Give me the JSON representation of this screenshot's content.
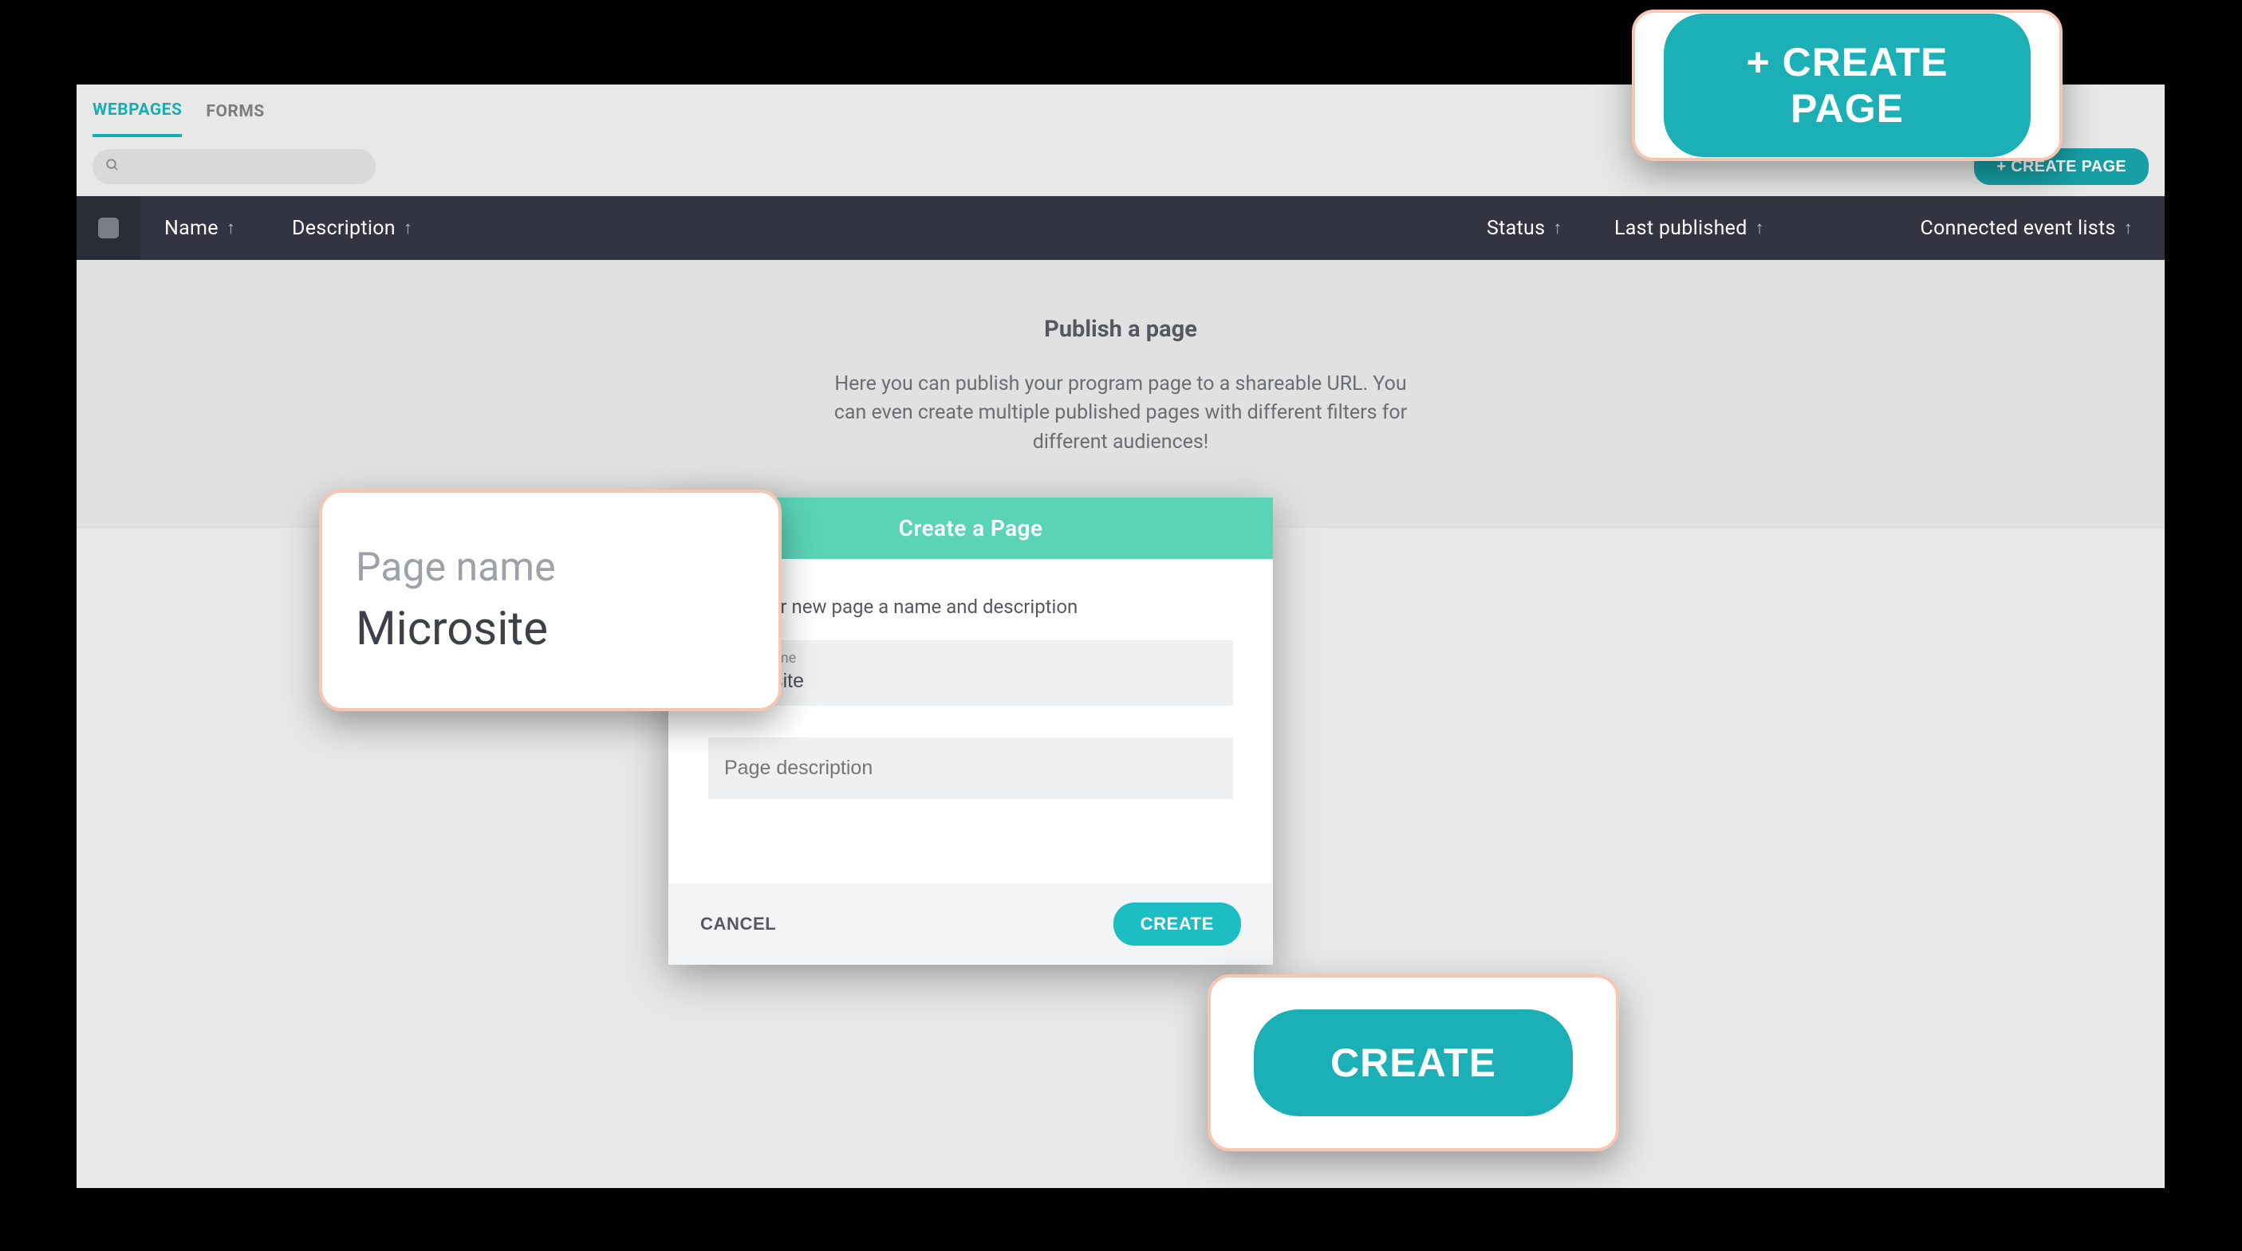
{
  "tabs": {
    "webpages": "WEBPAGES",
    "forms": "FORMS"
  },
  "toolbar": {
    "search_placeholder": "",
    "create_page_label": "+ CREATE PAGE"
  },
  "columns": {
    "name": "Name",
    "description": "Description",
    "status": "Status",
    "last_published": "Last published",
    "connected": "Connected event lists"
  },
  "empty": {
    "title": "Publish a page",
    "desc": "Here you can publish your program page to a shareable URL. You can even create multiple published pages with different filters for different audiences!"
  },
  "modal": {
    "title": "Create a Page",
    "instruction": "Give your new page a name and description",
    "page_name_label": "Page name",
    "page_name_value": "Microsite",
    "page_desc_placeholder": "Page description",
    "cancel": "CANCEL",
    "create": "CREATE"
  },
  "callouts": {
    "create_page": "+ CREATE PAGE",
    "page_name_label": "Page name",
    "page_name_value": "Microsite",
    "create": "CREATE"
  }
}
